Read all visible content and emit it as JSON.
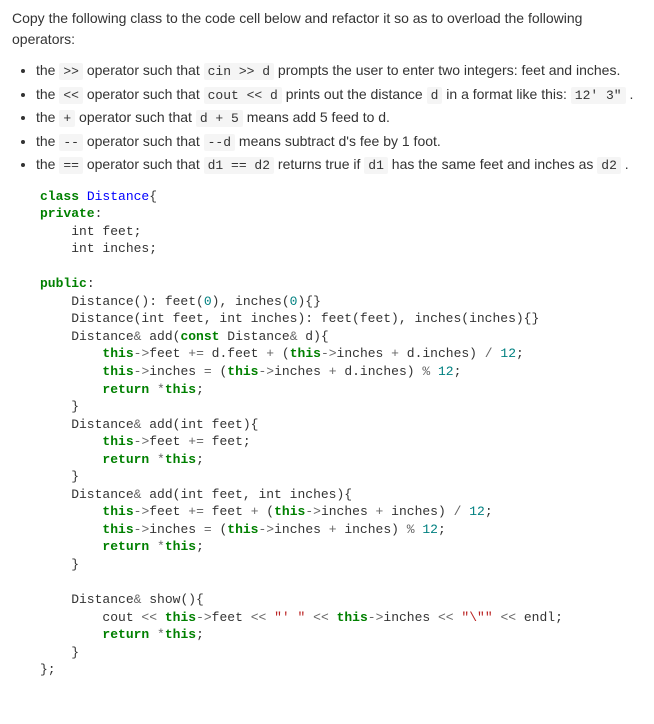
{
  "intro": "Copy the following class to the code cell below and refactor it so as to overload the following operators:",
  "bullets": [
    {
      "pre": "the ",
      "c1": ">>",
      "mid1": " operator such that ",
      "c2": "cin >> d",
      "mid2": " prompts the user to enter two integers: feet and inches.",
      "c3": "",
      "tail": ""
    },
    {
      "pre": "the ",
      "c1": "<<",
      "mid1": " operator such that ",
      "c2": "cout << d",
      "mid2": " prints out the distance ",
      "c3": "d",
      "mid3": " in a format like this: ",
      "c4": "12'  3\"",
      "tail": " ."
    },
    {
      "pre": "the ",
      "c1": "+",
      "mid1": " operator such that ",
      "c2": "d + 5",
      "mid2": " means add 5 feed to d.",
      "c3": "",
      "tail": ""
    },
    {
      "pre": "the ",
      "c1": "--",
      "mid1": " operator such that ",
      "c2": "--d",
      "mid2": " means subtract d's fee by 1 foot.",
      "c3": "",
      "tail": ""
    },
    {
      "pre": "the ",
      "c1": "==",
      "mid1": " operator such that ",
      "c2": "d1 == d2",
      "mid2": " returns true if ",
      "c3": "d1",
      "mid3": " has the same feet and inches as ",
      "c4": "d2",
      "tail": " ."
    }
  ],
  "code": {
    "l1_a": "class",
    "l1_b": " ",
    "l1_c": "Distance",
    "l1_d": "{",
    "l2_a": "private",
    "l2_b": ":",
    "l3": "    int feet;",
    "l4": "    int inches;",
    "l5": "",
    "l6_a": "public",
    "l6_b": ":",
    "l7_a": "    Distance(): feet(",
    "l7_b": "0",
    "l7_c": "), inches(",
    "l7_d": "0",
    "l7_e": "){}",
    "l8": "    Distance(int feet, int inches): feet(feet), inches(inches){}",
    "l9_a": "    Distance",
    "l9_b": "&",
    "l9_c": " add(",
    "l9_d": "const",
    "l9_e": " Distance",
    "l9_f": "&",
    "l9_g": " d){",
    "l10_a": "        ",
    "l10_b": "this",
    "l10_c": "->",
    "l10_d": "feet ",
    "l10_e": "+=",
    "l10_f": " d.feet ",
    "l10_g": "+",
    "l10_h": " (",
    "l10_i": "this",
    "l10_j": "->",
    "l10_k": "inches ",
    "l10_l": "+",
    "l10_m": " d.inches) ",
    "l10_n": "/",
    "l10_o": " ",
    "l10_p": "12",
    "l10_q": ";",
    "l11_a": "        ",
    "l11_b": "this",
    "l11_c": "->",
    "l11_d": "inches ",
    "l11_e": "=",
    "l11_f": " (",
    "l11_g": "this",
    "l11_h": "->",
    "l11_i": "inches ",
    "l11_j": "+",
    "l11_k": " d.inches) ",
    "l11_l": "%",
    "l11_m": " ",
    "l11_n": "12",
    "l11_o": ";",
    "l12_a": "        ",
    "l12_b": "return",
    "l12_c": " ",
    "l12_d": "*",
    "l12_e": "this",
    "l12_f": ";",
    "l13": "    }",
    "l14_a": "    Distance",
    "l14_b": "&",
    "l14_c": " add(int feet){",
    "l15_a": "        ",
    "l15_b": "this",
    "l15_c": "->",
    "l15_d": "feet ",
    "l15_e": "+=",
    "l15_f": " feet;",
    "l16_a": "        ",
    "l16_b": "return",
    "l16_c": " ",
    "l16_d": "*",
    "l16_e": "this",
    "l16_f": ";",
    "l17": "    }",
    "l18_a": "    Distance",
    "l18_b": "&",
    "l18_c": " add(int feet, int inches){",
    "l19_a": "        ",
    "l19_b": "this",
    "l19_c": "->",
    "l19_d": "feet ",
    "l19_e": "+=",
    "l19_f": " feet ",
    "l19_g": "+",
    "l19_h": " (",
    "l19_i": "this",
    "l19_j": "->",
    "l19_k": "inches ",
    "l19_l": "+",
    "l19_m": " inches) ",
    "l19_n": "/",
    "l19_o": " ",
    "l19_p": "12",
    "l19_q": ";",
    "l20_a": "        ",
    "l20_b": "this",
    "l20_c": "->",
    "l20_d": "inches ",
    "l20_e": "=",
    "l20_f": " (",
    "l20_g": "this",
    "l20_h": "->",
    "l20_i": "inches ",
    "l20_j": "+",
    "l20_k": " inches) ",
    "l20_l": "%",
    "l20_m": " ",
    "l20_n": "12",
    "l20_o": ";",
    "l21_a": "        ",
    "l21_b": "return",
    "l21_c": " ",
    "l21_d": "*",
    "l21_e": "this",
    "l21_f": ";",
    "l22": "    }",
    "l23": "",
    "l24_a": "    Distance",
    "l24_b": "&",
    "l24_c": " show(){",
    "l25_a": "        cout ",
    "l25_b": "<<",
    "l25_c": " ",
    "l25_d": "this",
    "l25_e": "->",
    "l25_f": "feet ",
    "l25_g": "<<",
    "l25_h": " ",
    "l25_i": "\"' \"",
    "l25_j": " ",
    "l25_k": "<<",
    "l25_l": " ",
    "l25_m": "this",
    "l25_n": "->",
    "l25_o": "inches ",
    "l25_p": "<<",
    "l25_q": " ",
    "l25_r": "\"\\\"\"",
    "l25_s": " ",
    "l25_t": "<<",
    "l25_u": " endl;",
    "l26_a": "        ",
    "l26_b": "return",
    "l26_c": " ",
    "l26_d": "*",
    "l26_e": "this",
    "l26_f": ";",
    "l27": "    }",
    "l28": "};"
  }
}
